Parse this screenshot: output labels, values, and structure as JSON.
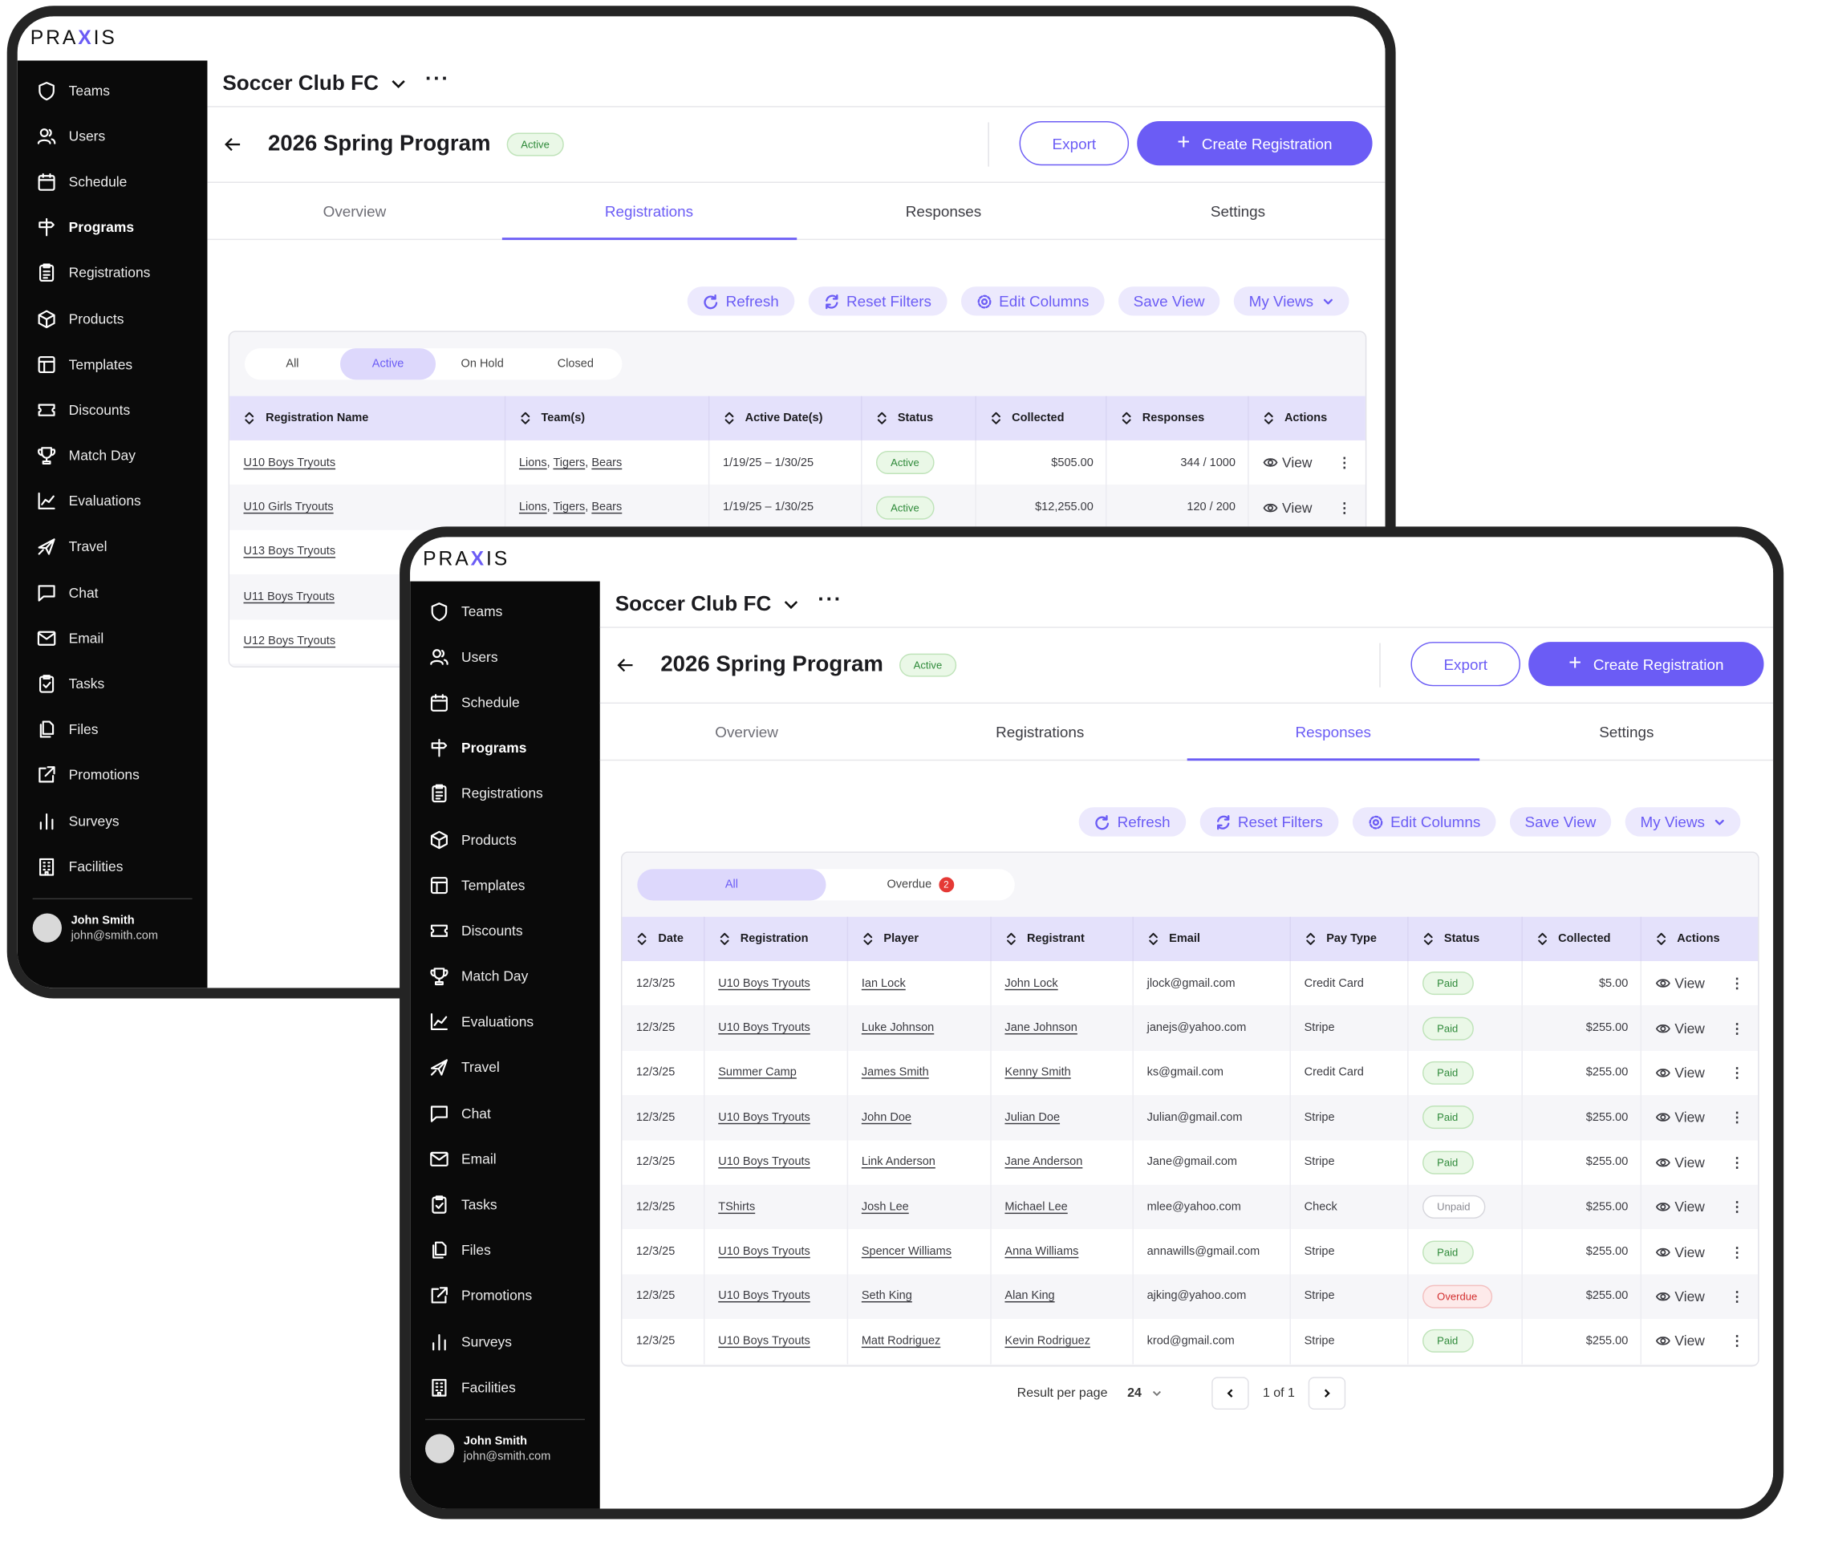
{
  "brand": "PRAXIS",
  "nav": [
    "Teams",
    "Users",
    "Schedule",
    "Programs",
    "Registrations",
    "Products",
    "Templates",
    "Discounts",
    "Match Day",
    "Evaluations",
    "Travel",
    "Chat",
    "Email",
    "Tasks",
    "Files",
    "Promotions",
    "Surveys",
    "Facilities"
  ],
  "nav_icons": [
    "shield-icon",
    "users-icon",
    "calendar-icon",
    "signpost-icon",
    "clipboard-icon",
    "box-icon",
    "template-icon",
    "ticket-icon",
    "trophy-icon",
    "chart-line-icon",
    "plane-icon",
    "chat-icon",
    "mail-icon",
    "task-icon",
    "files-icon",
    "external-link-icon",
    "bar-chart-icon",
    "building-icon"
  ],
  "user": {
    "name": "John Smith",
    "email": "john@smith.com"
  },
  "org": {
    "name": "Soccer Club FC"
  },
  "program": {
    "title": "2026 Spring Program",
    "status": "Active"
  },
  "buttons": {
    "export": "Export",
    "create": "Create Registration"
  },
  "tabs": [
    "Overview",
    "Registrations",
    "Responses",
    "Settings"
  ],
  "toolbar": {
    "refresh": "Refresh",
    "reset": "Reset Filters",
    "edit": "Edit Columns",
    "save": "Save View",
    "views": "My Views"
  },
  "colors": {
    "accent": "#6b5cf5",
    "header_bg": "#e4e1fb",
    "paid": "#2f8a3a",
    "overdue": "#d32f2f"
  },
  "registrations_screen": {
    "active_tab": "Registrations",
    "filters": [
      "All",
      "Active",
      "On Hold",
      "Closed"
    ],
    "active_filter": "Active",
    "columns": [
      "Registration Name",
      "Team(s)",
      "Active Date(s)",
      "Status",
      "Collected",
      "Responses",
      "Actions"
    ],
    "rows": [
      {
        "name": "U10 Boys Tryouts",
        "teams": [
          "Lions",
          "Tigers",
          "Bears"
        ],
        "dates": "1/19/25 – 1/30/25",
        "status": "Active",
        "collected": "$505.00",
        "responses": "344 / 1000",
        "action": "View"
      },
      {
        "name": "U10 Girls Tryouts",
        "teams": [
          "Lions",
          "Tigers",
          "Bears"
        ],
        "dates": "1/19/25 – 1/30/25",
        "status": "Active",
        "collected": "$12,255.00",
        "responses": "120 / 200",
        "action": "View"
      },
      {
        "name": "U13 Boys Tryouts"
      },
      {
        "name": "U11 Boys Tryouts"
      },
      {
        "name": "U12 Boys Tryouts"
      }
    ]
  },
  "responses_screen": {
    "active_tab": "Responses",
    "filters": [
      "All",
      "Overdue"
    ],
    "overdue_count": "2",
    "active_filter": "All",
    "columns": [
      "Date",
      "Registration",
      "Player",
      "Registrant",
      "Email",
      "Pay Type",
      "Status",
      "Collected",
      "Actions"
    ],
    "rows": [
      {
        "date": "12/3/25",
        "registration": "U10 Boys Tryouts",
        "player": "Ian Lock",
        "registrant": "John Lock",
        "email": "jlock@gmail.com",
        "pay": "Credit Card",
        "status": "Paid",
        "collected": "$5.00",
        "action": "View"
      },
      {
        "date": "12/3/25",
        "registration": "U10 Boys Tryouts",
        "player": "Luke Johnson",
        "registrant": "Jane Johnson",
        "email": "janejs@yahoo.com",
        "pay": "Stripe",
        "status": "Paid",
        "collected": "$255.00",
        "action": "View"
      },
      {
        "date": "12/3/25",
        "registration": "Summer Camp",
        "player": "James Smith",
        "registrant": "Kenny Smith",
        "email": "ks@gmail.com",
        "pay": "Credit Card",
        "status": "Paid",
        "collected": "$255.00",
        "action": "View"
      },
      {
        "date": "12/3/25",
        "registration": "U10 Boys Tryouts",
        "player": "John Doe",
        "registrant": "Julian Doe",
        "email": "Julian@gmail.com",
        "pay": "Stripe",
        "status": "Paid",
        "collected": "$255.00",
        "action": "View"
      },
      {
        "date": "12/3/25",
        "registration": "U10 Boys Tryouts",
        "player": "Link Anderson",
        "registrant": "Jane Anderson",
        "email": "Jane@gmail.com",
        "pay": "Stripe",
        "status": "Paid",
        "collected": "$255.00",
        "action": "View"
      },
      {
        "date": "12/3/25",
        "registration": "TShirts",
        "player": "Josh Lee",
        "registrant": "Michael Lee",
        "email": "mlee@yahoo.com",
        "pay": "Check",
        "status": "Unpaid",
        "collected": "$255.00",
        "action": "View"
      },
      {
        "date": "12/3/25",
        "registration": "U10 Boys Tryouts",
        "player": "Spencer Williams",
        "registrant": "Anna Williams",
        "email": "annawills@gmail.com",
        "pay": "Stripe",
        "status": "Paid",
        "collected": "$255.00",
        "action": "View"
      },
      {
        "date": "12/3/25",
        "registration": "U10 Boys Tryouts",
        "player": "Seth King",
        "registrant": "Alan King",
        "email": "ajking@yahoo.com",
        "pay": "Stripe",
        "status": "Overdue",
        "collected": "$255.00",
        "action": "View"
      },
      {
        "date": "12/3/25",
        "registration": "U10 Boys Tryouts",
        "player": "Matt Rodriguez",
        "registrant": "Kevin Rodriguez",
        "email": "krod@gmail.com",
        "pay": "Stripe",
        "status": "Paid",
        "collected": "$255.00",
        "action": "View"
      }
    ],
    "pagination": {
      "label": "Result per page",
      "per_page": "24",
      "page_info": "1 of 1"
    }
  }
}
